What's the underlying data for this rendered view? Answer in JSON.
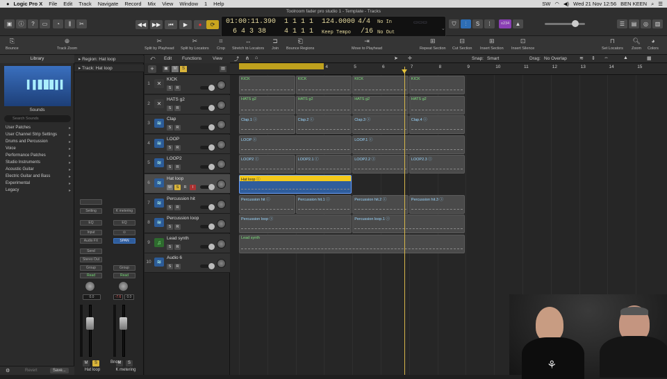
{
  "menubar": {
    "app": "Logic Pro X",
    "items": [
      "File",
      "Edit",
      "Track",
      "Navigate",
      "Record",
      "Mix",
      "View",
      "Window",
      "1",
      "Help"
    ],
    "clock": "Wed 21 Nov  12:56",
    "user": "BEN KEEN",
    "network": "SW"
  },
  "window_title": "Toolroom fader pro studio 1 - Template - Tracks",
  "lcd": {
    "smpte": "01:00:11.390",
    "bars": "6 4 3   38",
    "pos_top": "1 1 1   1",
    "pos_bottom": "4 1 1   1",
    "tempo": "124.0000",
    "tempo_mode": "Keep Tempo",
    "sig": "4/4",
    "div": "/16",
    "in": "No In",
    "out": "No Out"
  },
  "control_right": {
    "badge": "≡234"
  },
  "toolbar": {
    "tools": [
      "Bounce",
      "Track Zoom",
      "Split by Playhead",
      "Split by Locators",
      "Crop",
      "Stretch to Locators",
      "Join",
      "Bounce Regions",
      "Move to Playhead",
      "Repeat Section",
      "Cut Section",
      "Insert Section",
      "Insert Silence",
      "Set Locators",
      "Zoom",
      "Colors"
    ]
  },
  "library": {
    "title": "Library",
    "sounds_label": "Sounds",
    "search_placeholder": "Search Sounds",
    "items": [
      "User Patches",
      "User Channel Strip Settings",
      "Drums and Percussion",
      "Voice",
      "Performance Patches",
      "Studio Instruments",
      "Acoustic Guitar",
      "Electric Guitar and Bass",
      "Experimental",
      "Legacy"
    ],
    "revert": "Revert",
    "save": "Save..."
  },
  "inspector": {
    "region": "Region: Hat loop",
    "track": "Track: Hat loop",
    "strip1": {
      "setting": "Setting",
      "eq": "EQ",
      "input": "Input",
      "audio_fx": "Audio FX",
      "send": "Send",
      "output": "Stereo Out",
      "group": "Group",
      "automation": "Read",
      "value": "0.0",
      "name": "Hat loop"
    },
    "strip2": {
      "setting": "K metering",
      "eq": "EQ",
      "audio_fx": "SPAN",
      "group": "Group",
      "automation": "Read",
      "value": "-7.6",
      "value2": "0.0",
      "name": "Bnce",
      "name2": "K metering"
    }
  },
  "tracks_menu": {
    "edit": "Edit",
    "functions": "Functions",
    "view": "View"
  },
  "arrange_menu": {
    "snap_label": "Snap:",
    "snap": "Smart",
    "drag_label": "Drag:",
    "drag": "No Overlap"
  },
  "ruler": [
    "1",
    "2",
    "3",
    "4",
    "5",
    "6",
    "7",
    "8",
    "9",
    "10",
    "11",
    "12",
    "13",
    "14",
    "15"
  ],
  "tracks": [
    {
      "num": "1",
      "name": "KICK",
      "type": "drm"
    },
    {
      "num": "2",
      "name": "HATS g2",
      "type": "drm"
    },
    {
      "num": "3",
      "name": "Clap",
      "type": "aud"
    },
    {
      "num": "4",
      "name": "LOOP",
      "type": "aud"
    },
    {
      "num": "5",
      "name": "LOOP2",
      "type": "aud"
    },
    {
      "num": "6",
      "name": "Hat loop",
      "type": "aud"
    },
    {
      "num": "7",
      "name": "Percussion hit",
      "type": "aud"
    },
    {
      "num": "8",
      "name": "Percussion loop",
      "type": "aud"
    },
    {
      "num": "9",
      "name": "Lead synth",
      "type": "ins"
    },
    {
      "num": "10",
      "name": "Audio 6",
      "type": "aud"
    }
  ],
  "regions": [
    {
      "row": 0,
      "start": 1,
      "len": 1,
      "name": "KICK",
      "green": true
    },
    {
      "row": 0,
      "start": 2,
      "len": 1,
      "name": "KICK",
      "green": true
    },
    {
      "row": 0,
      "start": 3,
      "len": 1,
      "name": "KICK",
      "green": true
    },
    {
      "row": 0,
      "start": 4,
      "len": 1,
      "name": "KICK",
      "green": true
    },
    {
      "row": 1,
      "start": 1,
      "len": 1,
      "name": "HATS g2",
      "green": true
    },
    {
      "row": 1,
      "start": 2,
      "len": 1,
      "name": "HATS g2",
      "green": true
    },
    {
      "row": 1,
      "start": 3,
      "len": 1,
      "name": "HATS g2",
      "green": true
    },
    {
      "row": 1,
      "start": 4,
      "len": 1,
      "name": "HATS g2",
      "green": true
    },
    {
      "row": 2,
      "start": 1,
      "len": 1,
      "name": "Clap.1 ⓘ"
    },
    {
      "row": 2,
      "start": 2,
      "len": 1,
      "name": "Clap.2 ⓘ"
    },
    {
      "row": 2,
      "start": 3,
      "len": 1,
      "name": "Clap.3 ⓘ"
    },
    {
      "row": 2,
      "start": 4,
      "len": 1,
      "name": "Clap.4 ⓘ"
    },
    {
      "row": 3,
      "start": 1,
      "len": 2,
      "name": "LOOP ⓘ"
    },
    {
      "row": 3,
      "start": 3,
      "len": 2,
      "name": "LOOP.1 ⓘ"
    },
    {
      "row": 4,
      "start": 1,
      "len": 1,
      "name": "LOOP2 ⓘ"
    },
    {
      "row": 4,
      "start": 2,
      "len": 1,
      "name": "LOOP2.1 ⓘ"
    },
    {
      "row": 4,
      "start": 3,
      "len": 1,
      "name": "LOOP2.2 ⓘ"
    },
    {
      "row": 4,
      "start": 4,
      "len": 1,
      "name": "LOOP2.3 ⓘ"
    },
    {
      "row": 5,
      "start": 1,
      "len": 2,
      "name": "Hat loop ⓘ",
      "selected": true
    },
    {
      "row": 6,
      "start": 1,
      "len": 1,
      "name": "Percussion hit ⓘ"
    },
    {
      "row": 6,
      "start": 2,
      "len": 1,
      "name": "Percussion hit.1 ⓘ"
    },
    {
      "row": 6,
      "start": 3,
      "len": 1,
      "name": "Percussion hit.2 ⓘ"
    },
    {
      "row": 6,
      "start": 4,
      "len": 1,
      "name": "Percussion hit.3 ⓘ"
    },
    {
      "row": 7,
      "start": 1,
      "len": 2,
      "name": "Percussion loop ⓘ"
    },
    {
      "row": 7,
      "start": 3,
      "len": 2,
      "name": "Percussion loop.1 ⓘ"
    },
    {
      "row": 8,
      "start": 1,
      "len": 4,
      "name": "Lead synth",
      "green": true
    }
  ]
}
